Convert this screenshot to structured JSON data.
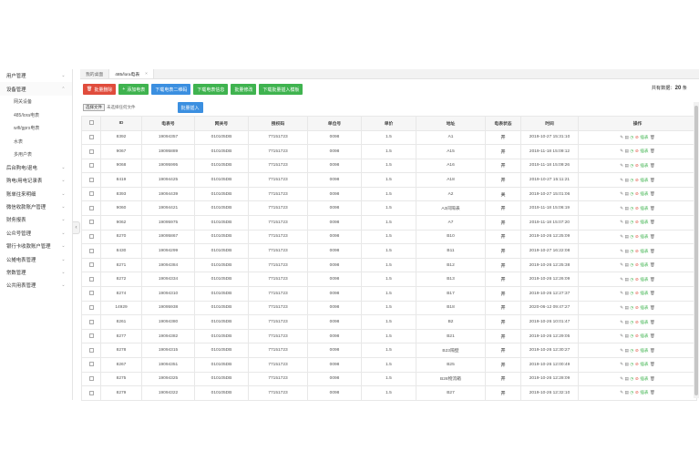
{
  "sidebar": {
    "items": [
      {
        "label": "用户管理",
        "level": 0,
        "chevron": "⌄"
      },
      {
        "label": "设备管理",
        "level": 0,
        "chevron": "⌃",
        "active": true
      },
      {
        "label": "网关设备",
        "level": 1
      },
      {
        "label": "485/lora电表",
        "level": 1
      },
      {
        "label": "wifi/gprs电表",
        "level": 1
      },
      {
        "label": "水表",
        "level": 1
      },
      {
        "label": "多用户表",
        "level": 1
      },
      {
        "label": "后台购电/退电",
        "level": 0,
        "chevron": "⌄"
      },
      {
        "label": "购电/用电记录表",
        "level": 0,
        "chevron": "⌄"
      },
      {
        "label": "账单往来明细",
        "level": 0,
        "chevron": "⌄"
      },
      {
        "label": "微信收款账户管理",
        "level": 0,
        "chevron": "⌄"
      },
      {
        "label": "财务报表",
        "level": 0,
        "chevron": "⌄"
      },
      {
        "label": "公众号管理",
        "level": 0,
        "chevron": "⌄"
      },
      {
        "label": "银行卡收款账户管理",
        "level": 0,
        "chevron": "⌄"
      },
      {
        "label": "公摊电表管理",
        "level": 0,
        "chevron": "⌄"
      },
      {
        "label": "常数管理",
        "level": 0,
        "chevron": "⌄"
      },
      {
        "label": "公共用表管理",
        "level": 0,
        "chevron": "⌄"
      }
    ],
    "collapse_glyph": "‹"
  },
  "tabs": [
    {
      "label": "我的桌面",
      "active": false
    },
    {
      "label": "485/lora电表",
      "active": true,
      "close": "×"
    }
  ],
  "toolbar": {
    "buttons": [
      {
        "label": "批量删除",
        "icon": "trash-icon",
        "color": "red",
        "glyph": "🗑"
      },
      {
        "label": "添加电表",
        "icon": "plus-icon",
        "color": "green",
        "glyph": "+"
      },
      {
        "label": "下载电表二维码",
        "color": "blue"
      },
      {
        "label": "下载电表信息",
        "color": "green"
      },
      {
        "label": "批量修改",
        "color": "green"
      },
      {
        "label": "下载批量插入模板",
        "color": "green"
      }
    ]
  },
  "total": {
    "prefix": "共有数据：",
    "count": "20",
    "suffix": " 条"
  },
  "file": {
    "button": "选择文件",
    "label": "未选择任何文件",
    "import": "批量插入"
  },
  "table": {
    "headers": [
      "",
      "ID",
      "电表号",
      "网关号",
      "授权码",
      "单位号",
      "单价",
      "地址",
      "电表状态",
      "时间",
      "操作"
    ],
    "rows": [
      [
        "8392",
        "19094357",
        "010105DB",
        "77151723",
        "0098",
        "1.5",
        "A1",
        "开",
        "2019-10-27 15:31:10"
      ],
      [
        "9067",
        "19095889",
        "010105DB",
        "77151723",
        "0098",
        "1.5",
        "A15",
        "开",
        "2019-11-18 15:09:12"
      ],
      [
        "9068",
        "19095995",
        "010105DB",
        "77151723",
        "0098",
        "1.5",
        "A16",
        "开",
        "2019-11-18 15:09:26"
      ],
      [
        "8419",
        "19094425",
        "010105DB",
        "77151723",
        "0098",
        "1.5",
        "A18",
        "开",
        "2019-10-27 15:11:21"
      ],
      [
        "8393",
        "19094439",
        "010105DB",
        "77151723",
        "0098",
        "1.5",
        "A2",
        "关",
        "2019-10-27 15:01:06"
      ],
      [
        "9060",
        "19094421",
        "010105DB",
        "77151723",
        "0098",
        "1.5",
        "A3间隔表",
        "开",
        "2019-11-18 15:06:19"
      ],
      [
        "9062",
        "19095975",
        "010105DB",
        "77151723",
        "0098",
        "1.5",
        "A7",
        "开",
        "2019-11-18 15:07:20"
      ],
      [
        "8270",
        "19095867",
        "010105DB",
        "77151723",
        "0098",
        "1.5",
        "B10",
        "开",
        "2019-10-26 12:25:09"
      ],
      [
        "8430",
        "19094299",
        "010105DB",
        "77151723",
        "0098",
        "1.5",
        "B11",
        "开",
        "2019-10-27 16:22:08"
      ],
      [
        "8271",
        "19094384",
        "010105DB",
        "77151723",
        "0098",
        "1.5",
        "B12",
        "开",
        "2019-10-26 12:25:38"
      ],
      [
        "8272",
        "19094334",
        "010105DB",
        "77151723",
        "0098",
        "1.5",
        "B13",
        "开",
        "2019-10-26 12:26:09"
      ],
      [
        "8274",
        "19094310",
        "010105DB",
        "77151723",
        "0098",
        "1.5",
        "B17",
        "开",
        "2019-10-26 12:27:37"
      ],
      [
        "14929",
        "19095938",
        "010105DB",
        "77151723",
        "0098",
        "1.5",
        "B18",
        "开",
        "2020-06-12 09:47:27"
      ],
      [
        "8261",
        "19094380",
        "010105DB",
        "77151723",
        "0098",
        "1.5",
        "B2",
        "开",
        "2019-10-26 10:01:47"
      ],
      [
        "8277",
        "19094382",
        "010105DB",
        "77151723",
        "0098",
        "1.5",
        "B21",
        "开",
        "2019-10-26 12:29:05"
      ],
      [
        "8278",
        "19094315",
        "010105DB",
        "77151723",
        "0098",
        "1.5",
        "B23隔壁",
        "开",
        "2019-10-26 12:30:27"
      ],
      [
        "8267",
        "19094351",
        "010105DB",
        "77151723",
        "0098",
        "1.5",
        "B25",
        "开",
        "2019-10-26 12:00:49"
      ],
      [
        "8275",
        "19094325",
        "010105DB",
        "77151723",
        "0098",
        "1.5",
        "B26物流箱",
        "开",
        "2019-10-26 12:28:09"
      ],
      [
        "8279",
        "19094322",
        "010105DB",
        "77151723",
        "0098",
        "1.5",
        "B27",
        "开",
        "2019-10-26 12:32:10"
      ]
    ],
    "ops": {
      "edit": "✎",
      "view": "▤",
      "toggle": "◷",
      "stop": "⊘",
      "text": "插表",
      "delete": "🗑"
    }
  },
  "colors": {
    "red": "#e04c3c",
    "green": "#3fb34f",
    "blue": "#3b8fe0"
  }
}
